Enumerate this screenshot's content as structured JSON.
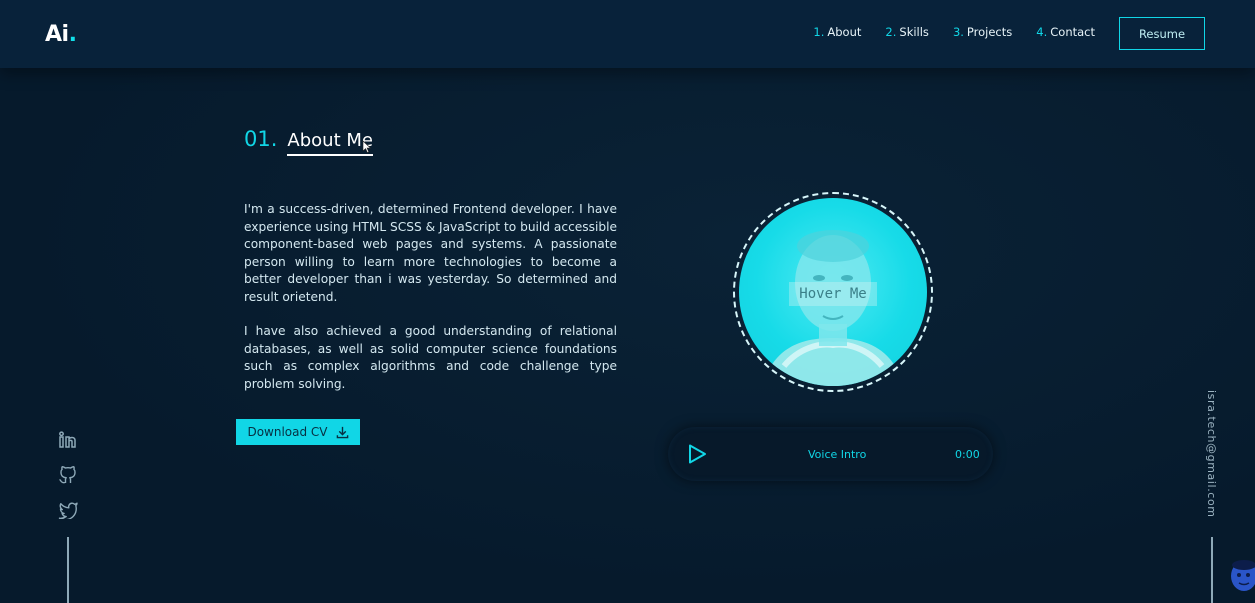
{
  "brand": {
    "logo": "Ai",
    "logo_dot": "."
  },
  "nav": {
    "items": [
      {
        "num": "1.",
        "label": "About"
      },
      {
        "num": "2.",
        "label": "Skills"
      },
      {
        "num": "3.",
        "label": "Projects"
      },
      {
        "num": "4.",
        "label": "Contact"
      }
    ],
    "resume_label": "Resume"
  },
  "section": {
    "num": "01.",
    "title": "About Me"
  },
  "about": {
    "paragraph1": "I'm a success-driven, determined Frontend developer. I have experience using HTML SCSS & JavaScript to build accessible component-based web pages and systems. A passionate person willing to learn more technologies to become a better developer than i was yesterday. So determined and result orietend.",
    "paragraph2": "I have also achieved a good understanding of relational databases, as well as solid computer science foundations such as complex algorithms and code challenge type problem solving."
  },
  "download_label": "Download CV",
  "profile": {
    "hover_text": "Hover Me"
  },
  "voice": {
    "label": "Voice Intro",
    "time": "0:00"
  },
  "socials": [
    "linkedin-icon",
    "github-icon",
    "twitter-icon"
  ],
  "email": "isra.tech@gmail.com",
  "colors": {
    "accent": "#11d6e6",
    "background": "#061a2c",
    "header": "#08223a"
  }
}
